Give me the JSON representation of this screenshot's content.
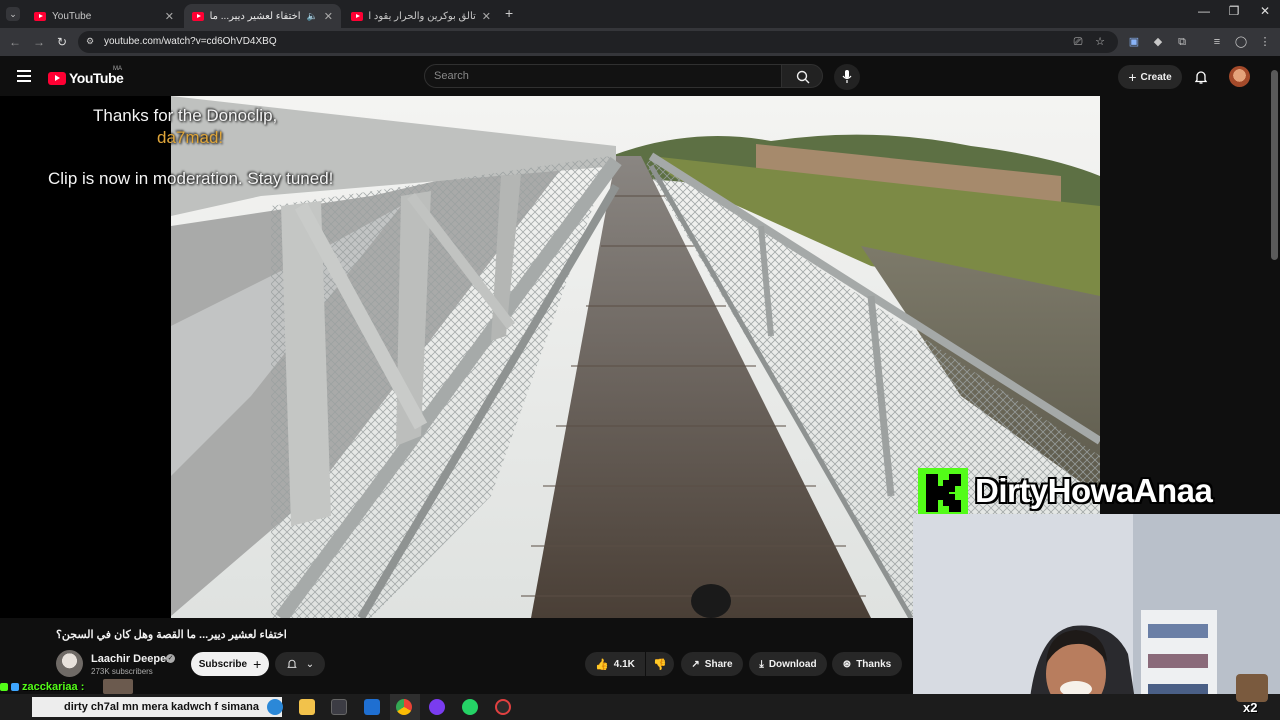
{
  "browser": {
    "tabs": [
      {
        "title": "YouTube",
        "active": false
      },
      {
        "title": "اختفاء لعشير ديير... ما القصة",
        "active": true
      },
      {
        "title": "تألق بوكرين والحرار يقود المغرب",
        "active": false
      }
    ],
    "new_tab_label": "+",
    "url": "youtube.com/watch?v=cd6OhVD4XBQ"
  },
  "youtube": {
    "logo_text": "YouTube",
    "region": "MA",
    "search_placeholder": "Search",
    "create_label": "Create"
  },
  "overlay": {
    "thanks_line": "Thanks for the Donoclip,",
    "donor": "da7mad!",
    "status_line": "Clip is now in moderation. Stay tuned!",
    "streamer_name": "DirtyHowaAnaa"
  },
  "video": {
    "title": "اختفاء لعشير ديير... ما القصة وهل كان في السجن؟",
    "channel": "Laachir Deeper",
    "subscribers": "273K subscribers",
    "subscribe_label": "Subscribe",
    "likes": "4.1K",
    "share_label": "Share",
    "download_label": "Download",
    "thanks_label": "Thanks"
  },
  "chat": {
    "username": "zaccka​riaa :",
    "message": "dirty ch7al mn mera kadwch f simana",
    "counter": "x2"
  },
  "colors": {
    "youtube_red": "#ff0033",
    "kick_green": "#53fc18",
    "donor_gold": "#e0a63a"
  }
}
